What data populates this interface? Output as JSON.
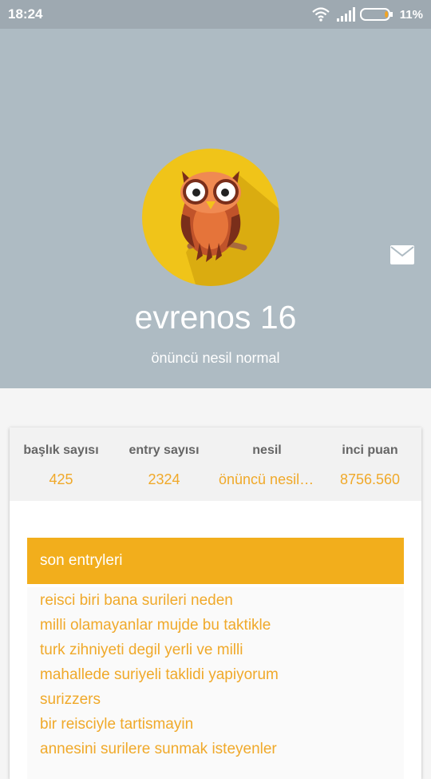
{
  "status_bar": {
    "time": "18:24",
    "battery_percent": "11%",
    "battery_level": 0.11,
    "icons": [
      "wifi-icon",
      "signal-icon",
      "battery-icon"
    ]
  },
  "profile": {
    "username": "evrenos 16",
    "title": "önüncü nesil normal",
    "avatar_icon": "owl-avatar-icon",
    "message_icon": "mail-icon"
  },
  "stats": [
    {
      "label": "başlık sayısı",
      "value": "425"
    },
    {
      "label": "entry sayısı",
      "value": "2324"
    },
    {
      "label": "nesil",
      "value": "önüncü nesil normal"
    },
    {
      "label": "inci puan",
      "value": "8756.560"
    }
  ],
  "recent": {
    "header": "son entryleri",
    "items": [
      "reisci biri bana surileri neden",
      "milli olamayanlar mujde bu taktikle",
      "turk zihniyeti degil yerli ve milli",
      "mahallede suriyeli taklidi yapiyorum",
      "surizzers",
      "bir reisciyle tartismayin",
      "annesini surilere sunmak isteyenler"
    ]
  },
  "colors": {
    "header_bg": "#aebbc3",
    "accent": "#f2ae1c",
    "link": "#f0a92a",
    "avatar_bg": "#f0c419"
  }
}
